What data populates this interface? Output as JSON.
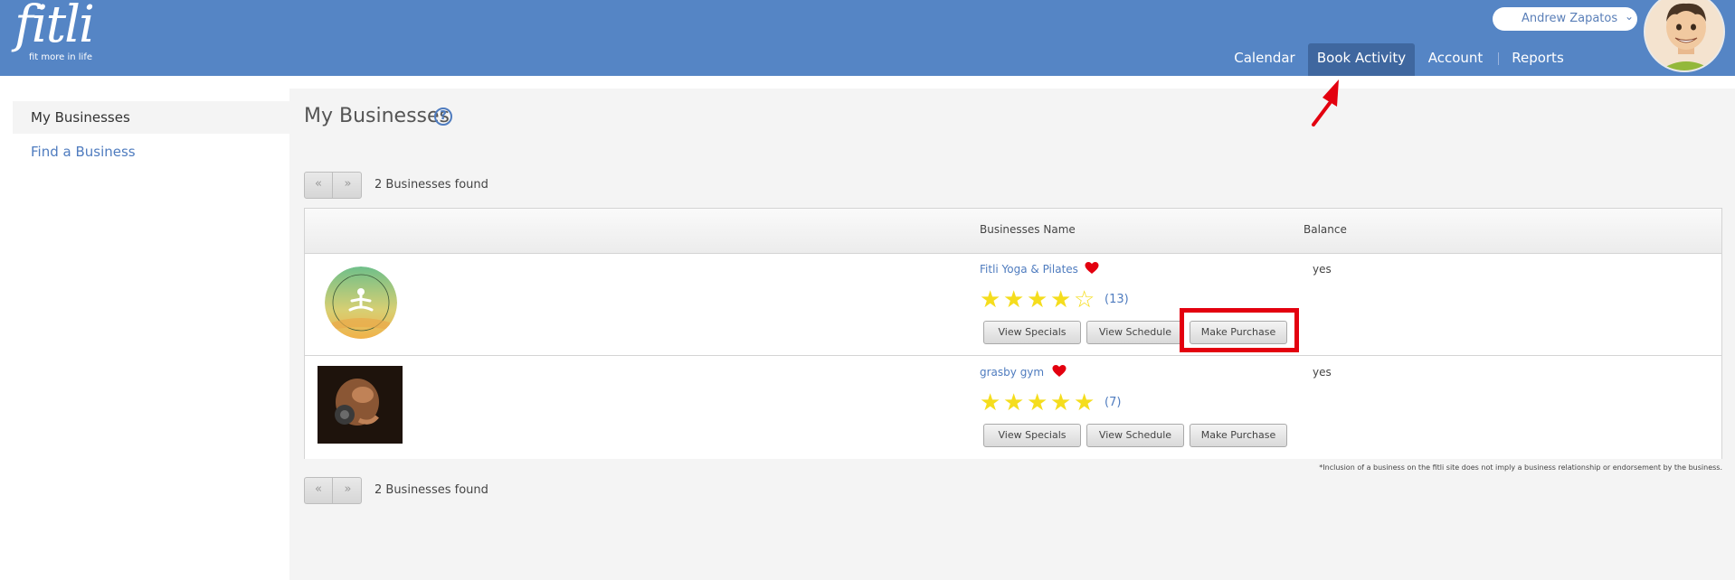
{
  "brand": {
    "name": "fitli",
    "tagline": "fit more in life"
  },
  "user": {
    "name": "Andrew Zapatos",
    "caret_icon": "double-chevron-down-icon"
  },
  "nav": {
    "items": [
      "Calendar",
      "Book Activity",
      "Account",
      "Reports"
    ],
    "active": "Book Activity"
  },
  "sidebar": {
    "items": [
      "My Businesses",
      "Find a Business"
    ],
    "active": "My Businesses"
  },
  "main": {
    "title": "My Businesses",
    "help_icon": "?",
    "pager": {
      "prev": "«",
      "next": "»"
    },
    "found_text": "2 Businesses found",
    "table": {
      "headers": [
        "Businesses Name",
        "Balance"
      ],
      "rows": [
        {
          "name": "Fitli Yoga & Pilates",
          "rating": 4,
          "reviews": "(13)",
          "balance": "yes"
        },
        {
          "name": "grasby gym",
          "rating": 5,
          "reviews": "(7)",
          "balance": "yes"
        }
      ]
    },
    "buttons": {
      "specials": "View Specials",
      "schedule": "View Schedule",
      "purchase": "Make Purchase"
    },
    "disclaimer": "*Inclusion of a business on the fitli site does not imply a business relationship or endorsement by the business."
  },
  "colors": {
    "header": "#5585c5",
    "nav_active": "#3f679f",
    "link": "#4f7cbf",
    "star": "#f5dd1d",
    "heart": "#e3000f",
    "annotation": "#e3000f"
  }
}
